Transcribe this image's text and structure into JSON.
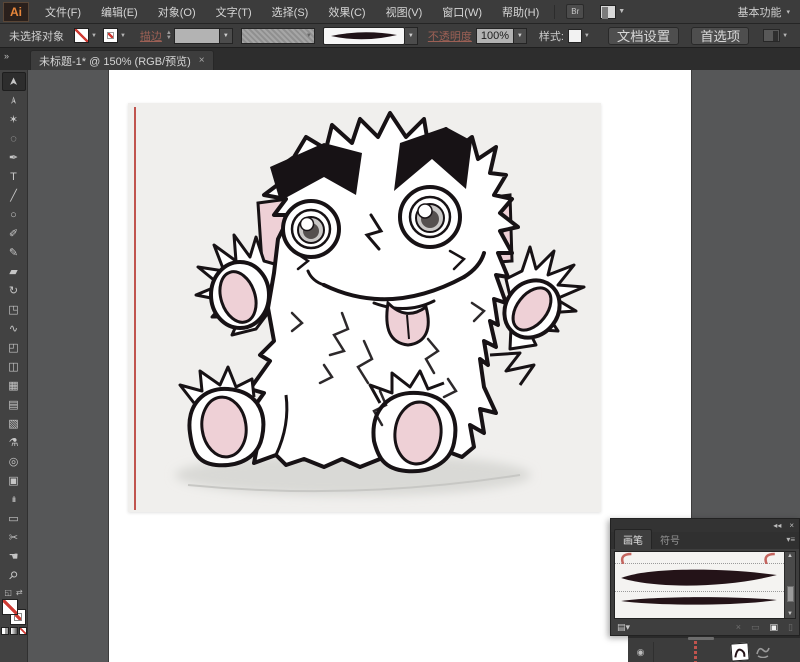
{
  "app": {
    "logo": "Ai",
    "workspace": "基本功能",
    "workspace_caret": "▾",
    "bridge_icon": "Br"
  },
  "menu": {
    "items": [
      "文件(F)",
      "编辑(E)",
      "对象(O)",
      "文字(T)",
      "选择(S)",
      "效果(C)",
      "视图(V)",
      "窗口(W)",
      "帮助(H)"
    ]
  },
  "controlbar": {
    "no_selection": "未选择对象",
    "stroke_label": "描边",
    "opacity_label": "不透明度",
    "opacity_value": "100%",
    "style_label": "样式:",
    "doc_setup": "文档设置",
    "preferences": "首选项",
    "stepper_up": "▲",
    "stepper_down": "▼",
    "dd_caret": "▼"
  },
  "tab": {
    "title": "未标题-1* @ 150% (RGB/预览)",
    "close": "×",
    "overflow_chevrons": "»"
  },
  "toolbar": {
    "tools": [
      {
        "name": "selection-tool",
        "glyph": "➤"
      },
      {
        "name": "direct-selection-tool",
        "glyph": "➢"
      },
      {
        "name": "magic-wand-tool",
        "glyph": "✶"
      },
      {
        "name": "lasso-tool",
        "glyph": "◌"
      },
      {
        "name": "pen-tool",
        "glyph": "✒"
      },
      {
        "name": "type-tool",
        "glyph": "T"
      },
      {
        "name": "line-segment-tool",
        "glyph": "╱"
      },
      {
        "name": "shape-tool",
        "glyph": "○"
      },
      {
        "name": "paintbrush-tool",
        "glyph": "✐"
      },
      {
        "name": "pencil-tool",
        "glyph": "✎"
      },
      {
        "name": "eraser-tool",
        "glyph": "▰"
      },
      {
        "name": "rotate-tool",
        "glyph": "↻"
      },
      {
        "name": "scale-tool",
        "glyph": "◳"
      },
      {
        "name": "width-tool",
        "glyph": "∿"
      },
      {
        "name": "free-transform-tool",
        "glyph": "◰"
      },
      {
        "name": "shape-builder-tool",
        "glyph": "◫"
      },
      {
        "name": "perspective-grid-tool",
        "glyph": "▦"
      },
      {
        "name": "mesh-tool",
        "glyph": "▤"
      },
      {
        "name": "gradient-tool",
        "glyph": "▧"
      },
      {
        "name": "eyedropper-tool",
        "glyph": "⚗"
      },
      {
        "name": "blend-tool",
        "glyph": "◎"
      },
      {
        "name": "symbol-sprayer-tool",
        "glyph": "▣"
      },
      {
        "name": "column-graph-tool",
        "glyph": "ılı"
      },
      {
        "name": "artboard-tool",
        "glyph": "▭"
      },
      {
        "name": "slice-tool",
        "glyph": "✂"
      },
      {
        "name": "hand-tool",
        "glyph": "☚"
      },
      {
        "name": "zoom-tool",
        "glyph": "⚲"
      }
    ],
    "swap_icon": "⇄",
    "default_swatch_icon": "◱"
  },
  "panels": {
    "brushes": {
      "collapse": "◂◂",
      "close": "×",
      "tab_brushes": "画笔",
      "tab_symbols": "符号",
      "menu_icon": "▾≡",
      "scroll_up": "▲",
      "scroll_down": "▼",
      "library_icon": "▤▾",
      "remove_icon": "×",
      "options_icon": "▭",
      "new_icon": "▣",
      "trash_icon": "▯"
    },
    "dock": {
      "eye_icon": "◉"
    }
  },
  "palette": {
    "accent_red": "#c0544e",
    "pink": "#eed0d6",
    "ink": "#171215",
    "paper": "#f0efed",
    "shadow_c": "#d9d9d6",
    "disabled_link": "#9c6055"
  }
}
